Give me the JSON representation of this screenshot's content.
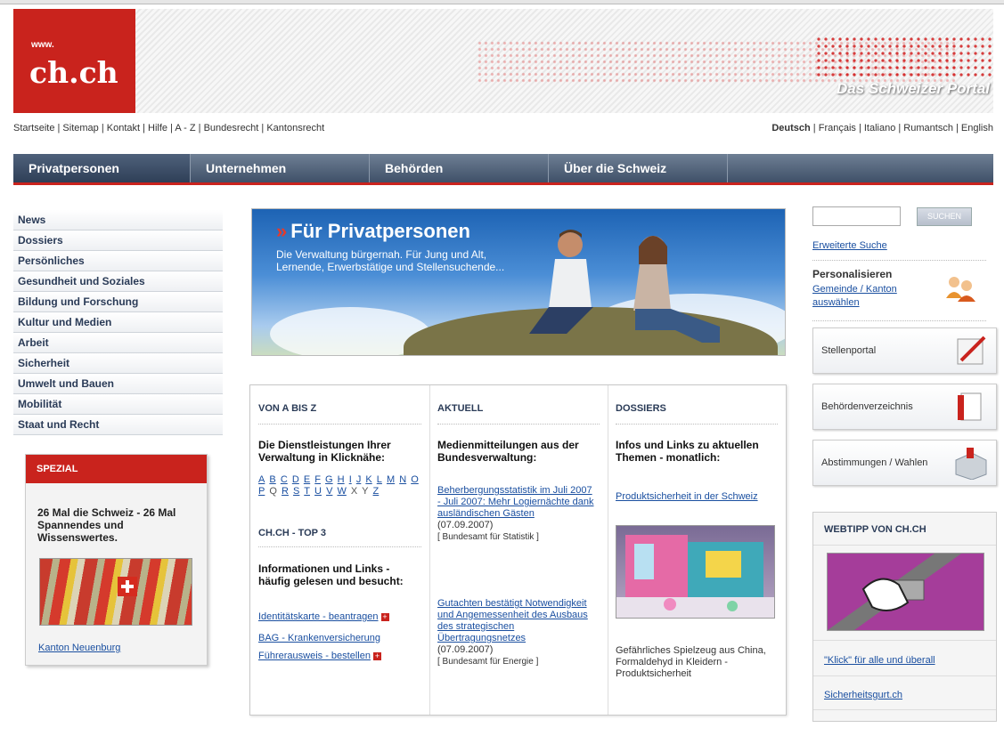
{
  "header": {
    "logo_www": "www.",
    "logo_name": "ch.ch",
    "tagline": "Das Schweizer Portal"
  },
  "utility_nav": {
    "links": "Startseite | Sitemap | Kontakt | Hilfe | A - Z | Bundesrecht | Kantonsrecht",
    "lang_active": "Deutsch",
    "lang_others": " | Français | Italiano | Rumantsch | English"
  },
  "main_nav": [
    "Privatpersonen",
    "Unternehmen",
    "Behörden",
    "Über die Schweiz"
  ],
  "sidebar": {
    "items": [
      "News",
      "Dossiers",
      "Persönliches",
      "Gesundheit und Soziales",
      "Bildung und Forschung",
      "Kultur und Medien",
      "Arbeit",
      "Sicherheit",
      "Umwelt und Bauen",
      "Mobilität",
      "Staat und Recht"
    ]
  },
  "spezial": {
    "header": "SPEZIAL",
    "text": "26 Mal die Schweiz - 26 Mal Spannendes und Wissenswertes.",
    "link": "Kanton Neuenburg"
  },
  "hero": {
    "chevron": "»",
    "title": "Für Privatpersonen",
    "subtitle": "Die Verwaltung bürgernah. Für Jung und Alt, Lernende, Erwerbstätige und Stellensuchende..."
  },
  "col_az": {
    "heading": "VON A BIS Z",
    "intro": "Die Dienstleistungen Ihrer Verwaltung in Klicknähe:",
    "letters": [
      {
        "l": "A",
        "link": true
      },
      {
        "l": "B",
        "link": true
      },
      {
        "l": "C",
        "link": true
      },
      {
        "l": "D",
        "link": true
      },
      {
        "l": "E",
        "link": true
      },
      {
        "l": "F",
        "link": true
      },
      {
        "l": "G",
        "link": true
      },
      {
        "l": "H",
        "link": true
      },
      {
        "l": "I",
        "link": true
      },
      {
        "l": "J",
        "link": true
      },
      {
        "l": "K",
        "link": true
      },
      {
        "l": "L",
        "link": true
      },
      {
        "l": "M",
        "link": true
      },
      {
        "l": "N",
        "link": true
      },
      {
        "l": "O",
        "link": true
      },
      {
        "l": "P",
        "link": true
      },
      {
        "l": "Q",
        "link": false
      },
      {
        "l": "R",
        "link": true
      },
      {
        "l": "S",
        "link": true
      },
      {
        "l": "T",
        "link": true
      },
      {
        "l": "U",
        "link": true
      },
      {
        "l": "V",
        "link": true
      },
      {
        "l": "W",
        "link": true
      },
      {
        "l": "X",
        "link": false
      },
      {
        "l": "Y",
        "link": false
      },
      {
        "l": "Z",
        "link": true
      }
    ],
    "top3_heading": "CH.CH - TOP 3",
    "top3_intro": "Informationen und Links - häufig gelesen und besucht:",
    "top3_links": [
      "Identitätskarte - beantragen",
      "BAG - Krankenversicherung",
      "Führerausweis - bestellen"
    ]
  },
  "col_aktuell": {
    "heading": "AKTUELL",
    "intro": "Medienmitteilungen aus der Bundesverwaltung:",
    "news": [
      {
        "link": "Beherbergungsstatistik im Juli 2007 - Juli 2007: Mehr Logiernächte dank ausländischen Gästen",
        "date": "(07.09.2007)",
        "source": "[ Bundesamt für Statistik ]"
      },
      {
        "link": "Gutachten bestätigt Notwendigkeit und Angemessenheit des Ausbaus des strategischen Übertragungsnetzes",
        "date": "(07.09.2007)",
        "source": "[ Bundesamt für Energie ]"
      }
    ]
  },
  "col_dossiers": {
    "heading": "DOSSIERS",
    "intro": "Infos und Links zu aktuellen Themen - monatlich:",
    "link": "Produktsicherheit in der Schweiz",
    "caption": "Gefährliches Spielzeug aus China, Formaldehyd in Kleidern - Produktsicherheit"
  },
  "right": {
    "search_value": "",
    "search_button": "SUCHEN",
    "advanced_search": "Erweiterte Suche",
    "personalize_title": "Personalisieren",
    "personalize_link": "Gemeinde / Kanton auswählen",
    "boxes": [
      "Stellenportal",
      "Behördenverzeichnis",
      "Abstimmungen / Wahlen"
    ],
    "webtipp_heading": "WEBTIPP VON CH.CH",
    "webtipp_links": [
      "\"Klick\" für alle und überall",
      "Sicherheitsgurt.ch"
    ]
  },
  "colors": {
    "brand_red": "#c9231d",
    "nav_blue": "#3f5068",
    "link": "#1a4fa0"
  }
}
